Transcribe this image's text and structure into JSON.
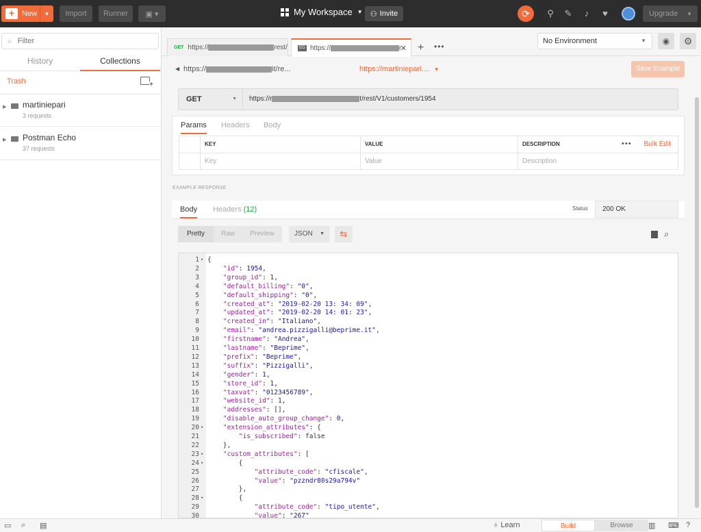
{
  "topbar": {
    "new_label": "New",
    "import_label": "Import",
    "runner_label": "Runner",
    "workspace_label": "My Workspace",
    "invite_label": "Invite",
    "upgrade_label": "Upgrade"
  },
  "sidebar": {
    "filter_placeholder": "Filter",
    "tabs": [
      {
        "label": "History"
      },
      {
        "label": "Collections"
      }
    ],
    "trash_label": "Trash",
    "collections": [
      {
        "name": "martiniepari",
        "count": "3 requests"
      },
      {
        "name": "Postman Echo",
        "count": "37 requests"
      }
    ]
  },
  "tabs": [
    {
      "method": "GET",
      "label": "https://",
      "suffix": "rest/"
    },
    {
      "method": "EG",
      "label": "https://",
      "suffix": "r"
    }
  ],
  "environment": {
    "selected": "No Environment"
  },
  "example": {
    "crumb_prefix": "https://",
    "crumb_suffix": "it/re...",
    "name": "https://martiniepari....",
    "save_label": "Save Example"
  },
  "request": {
    "method": "GET",
    "url_prefix": "https://r",
    "url_suffix": "t/rest/V1/customers/1954",
    "tabs": [
      {
        "label": "Params"
      },
      {
        "label": "Headers"
      },
      {
        "label": "Body"
      }
    ],
    "params": {
      "headers": [
        "KEY",
        "VALUE",
        "DESCRIPTION"
      ],
      "bulk_edit": "Bulk Edit",
      "placeholders": [
        "Key",
        "Value",
        "Description"
      ]
    }
  },
  "response": {
    "section_label": "EXAMPLE RESPONSE",
    "tabs": [
      {
        "label": "Body"
      },
      {
        "label": "Headers",
        "badge": "(12)"
      }
    ],
    "status_label": "Status",
    "status_value": "200 OK",
    "formats": [
      "Pretty",
      "Raw",
      "Preview"
    ],
    "language": "JSON",
    "code_lines": [
      {
        "n": "1",
        "fold": true,
        "t": "{"
      },
      {
        "n": "2",
        "t": "    \"id\": 1954,"
      },
      {
        "n": "3",
        "t": "    \"group_id\": 1,"
      },
      {
        "n": "4",
        "t": "    \"default_billing\": \"0\","
      },
      {
        "n": "5",
        "t": "    \"default_shipping\": \"0\","
      },
      {
        "n": "6",
        "t": "    \"created_at\": \"2019-02-20 13:34:09\","
      },
      {
        "n": "7",
        "t": "    \"updated_at\": \"2019-02-20 14:01:23\","
      },
      {
        "n": "8",
        "t": "    \"created_in\": \"Italiano\","
      },
      {
        "n": "9",
        "t": "    \"email\": \"andrea.pizzigalli@beprime.it\","
      },
      {
        "n": "10",
        "t": "    \"firstname\": \"Andrea\","
      },
      {
        "n": "11",
        "t": "    \"lastname\": \"Beprime\","
      },
      {
        "n": "12",
        "t": "    \"prefix\": \"Beprime\","
      },
      {
        "n": "13",
        "t": "    \"suffix\": \"Pizzigalli\","
      },
      {
        "n": "14",
        "t": "    \"gender\": 1,"
      },
      {
        "n": "15",
        "t": "    \"store_id\": 1,"
      },
      {
        "n": "16",
        "t": "    \"taxvat\": \"0123456789\","
      },
      {
        "n": "17",
        "t": "    \"website_id\": 1,"
      },
      {
        "n": "18",
        "t": "    \"addresses\": [],"
      },
      {
        "n": "19",
        "t": "    \"disable_auto_group_change\": 0,"
      },
      {
        "n": "20",
        "fold": true,
        "t": "    \"extension_attributes\": {"
      },
      {
        "n": "21",
        "t": "        \"is_subscribed\": false"
      },
      {
        "n": "22",
        "t": "    },"
      },
      {
        "n": "23",
        "fold": true,
        "t": "    \"custom_attributes\": ["
      },
      {
        "n": "24",
        "fold": true,
        "t": "        {"
      },
      {
        "n": "25",
        "t": "            \"attribute_code\": \"cfiscale\","
      },
      {
        "n": "26",
        "t": "            \"value\": \"pzzndr80s29a794v\""
      },
      {
        "n": "27",
        "t": "        },"
      },
      {
        "n": "28",
        "fold": true,
        "t": "        {"
      },
      {
        "n": "29",
        "t": "            \"attribute_code\": \"tipo_utente\","
      },
      {
        "n": "30",
        "t": "            \"value\": \"267\""
      }
    ]
  },
  "statusbar": {
    "learn_label": "Learn",
    "build_label": "Build",
    "browse_label": "Browse"
  }
}
